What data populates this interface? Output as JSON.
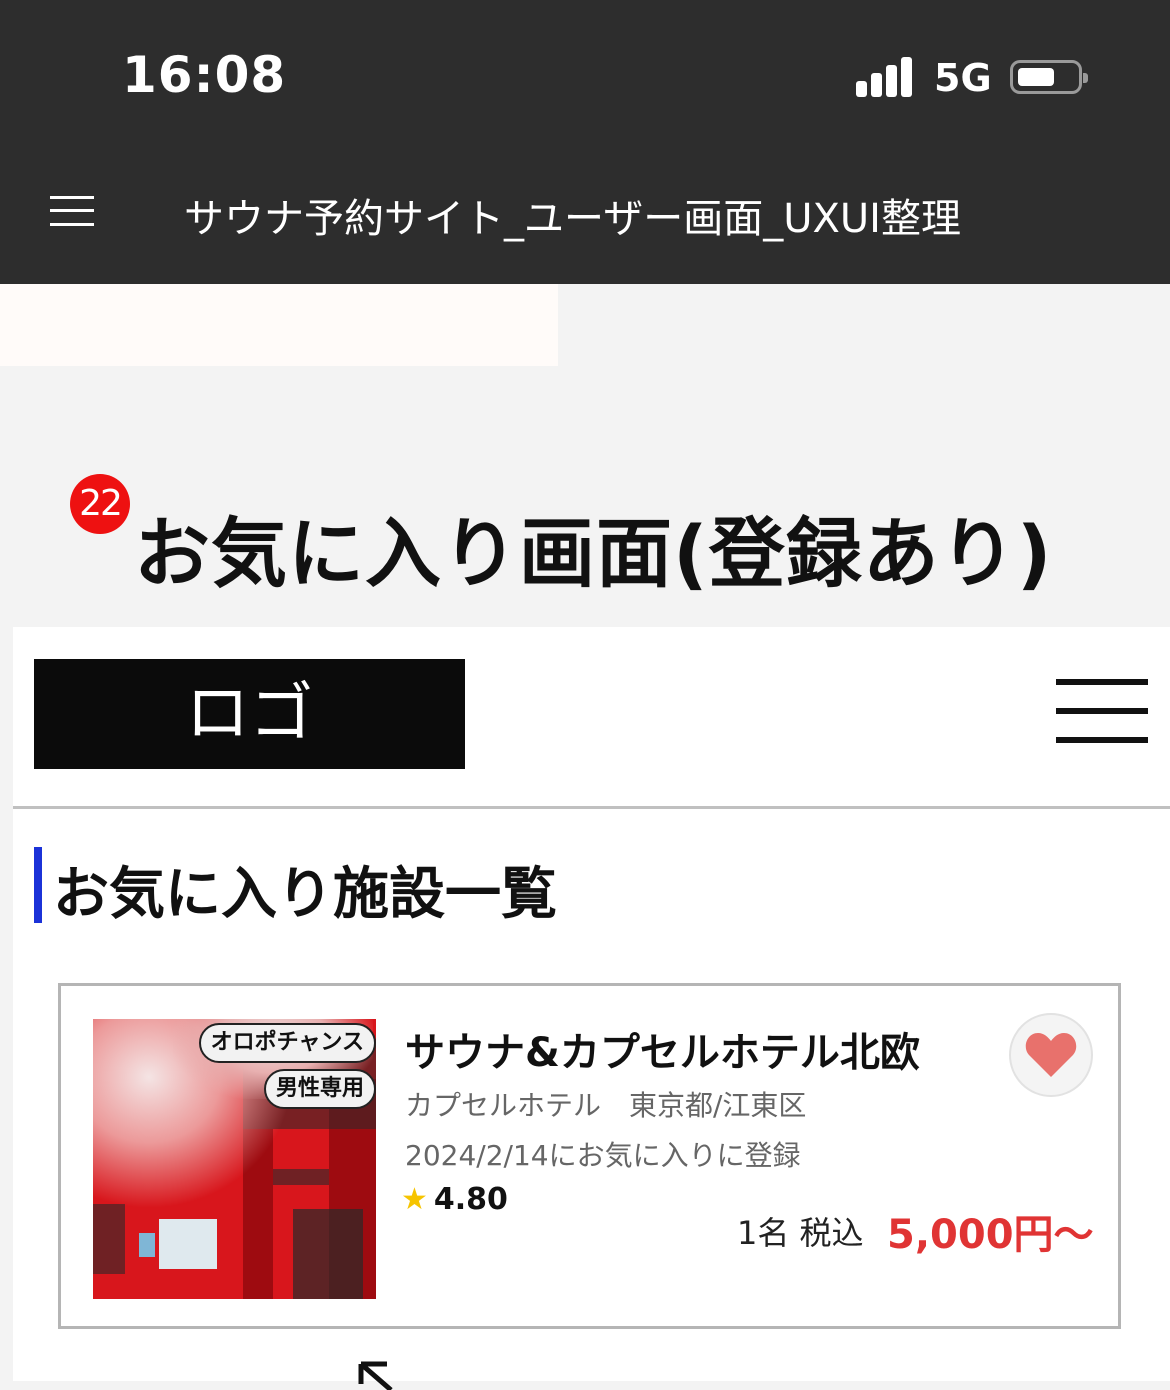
{
  "status_bar": {
    "time": "16:08",
    "network": "5G"
  },
  "app_bar": {
    "title": "サウナ予約サイト_ユーザー画面_UXUI整理"
  },
  "screen": {
    "badge_number": "22",
    "title": "お気に入り画面(登録あり)"
  },
  "site_header": {
    "logo_text": "ロゴ"
  },
  "section": {
    "title": "お気に入り施設一覧"
  },
  "favorite_card": {
    "tags": [
      "オロポチャンス",
      "男性専用"
    ],
    "name": "サウナ&カプセルホテル北欧",
    "meta": "カプセルホテル　東京都/江東区",
    "registered": "2024/2/14にお気に入りに登録",
    "rating": "4.80",
    "price_unit": "1名 税込",
    "price": "5,000円〜"
  },
  "colors": {
    "accent_bar": "#1b32d8",
    "price": "#e03434",
    "heart": "#e8716c",
    "badge": "#ee1111"
  }
}
